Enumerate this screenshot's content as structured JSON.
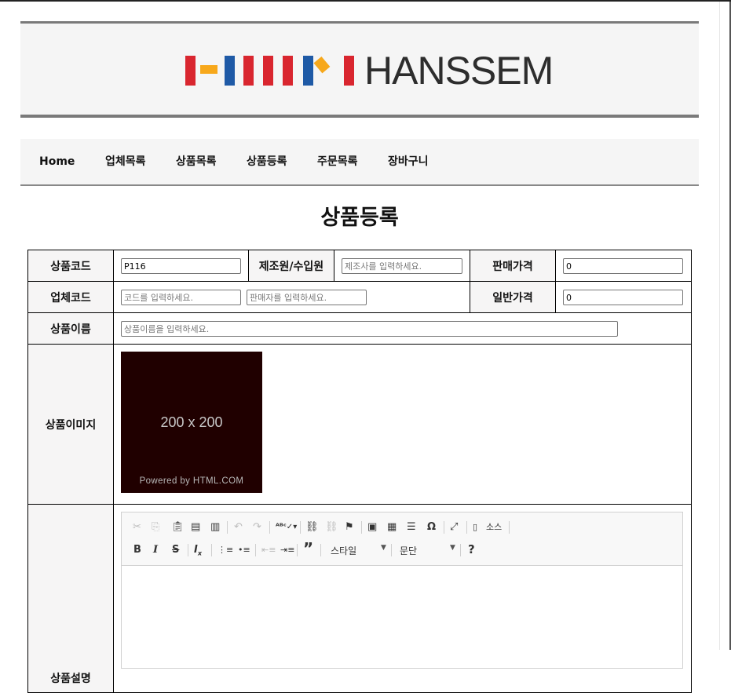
{
  "brand": {
    "name": "HANSSEM",
    "bar_colors": [
      "#d9262f",
      "#f7a81b",
      "#1f5aa6",
      "#d9262f",
      "#d9262f",
      "#1f5aa6",
      "#f7a81b",
      "#d9262f"
    ]
  },
  "nav": {
    "items": [
      {
        "label": "Home"
      },
      {
        "label": "업체목록"
      },
      {
        "label": "상품목록"
      },
      {
        "label": "상품등록"
      },
      {
        "label": "주문목록"
      },
      {
        "label": "장바구니"
      }
    ]
  },
  "page": {
    "title": "상품등록"
  },
  "form": {
    "product_code": {
      "label": "상품코드",
      "value": "P116"
    },
    "manufacturer": {
      "label": "제조원/수입원",
      "placeholder": "제조사를 입력하세요."
    },
    "sale_price": {
      "label": "판매가격",
      "value": "0"
    },
    "vendor_code": {
      "label": "업체코드",
      "code_placeholder": "코드를 입력하세요.",
      "seller_placeholder": "판매자를 입력하세요."
    },
    "regular_price": {
      "label": "일반가격",
      "value": "0"
    },
    "product_name": {
      "label": "상품이름",
      "placeholder": "상품이름을 입력하세요."
    },
    "product_image": {
      "label": "상품이미지",
      "image_text": "200 x 200",
      "image_caption": "Powered by HTML.COM"
    },
    "description": {
      "label": "상품설명"
    }
  },
  "editor": {
    "source_label": "소스",
    "style_combo": "스타일",
    "format_combo": "문단",
    "icons": [
      "cut-icon",
      "copy-icon",
      "paste-icon",
      "paste-text-icon",
      "paste-word-icon",
      "undo-icon",
      "redo-icon",
      "spellcheck-icon",
      "link-icon",
      "unlink-icon",
      "anchor-icon",
      "image-icon",
      "table-icon",
      "horizontal-rule-icon",
      "special-char-icon",
      "maximize-icon",
      "source-icon",
      "bold-icon",
      "italic-icon",
      "strike-icon",
      "remove-format-icon",
      "numbered-list-icon",
      "bulleted-list-icon",
      "outdent-icon",
      "indent-icon",
      "blockquote-icon",
      "help-icon"
    ]
  }
}
